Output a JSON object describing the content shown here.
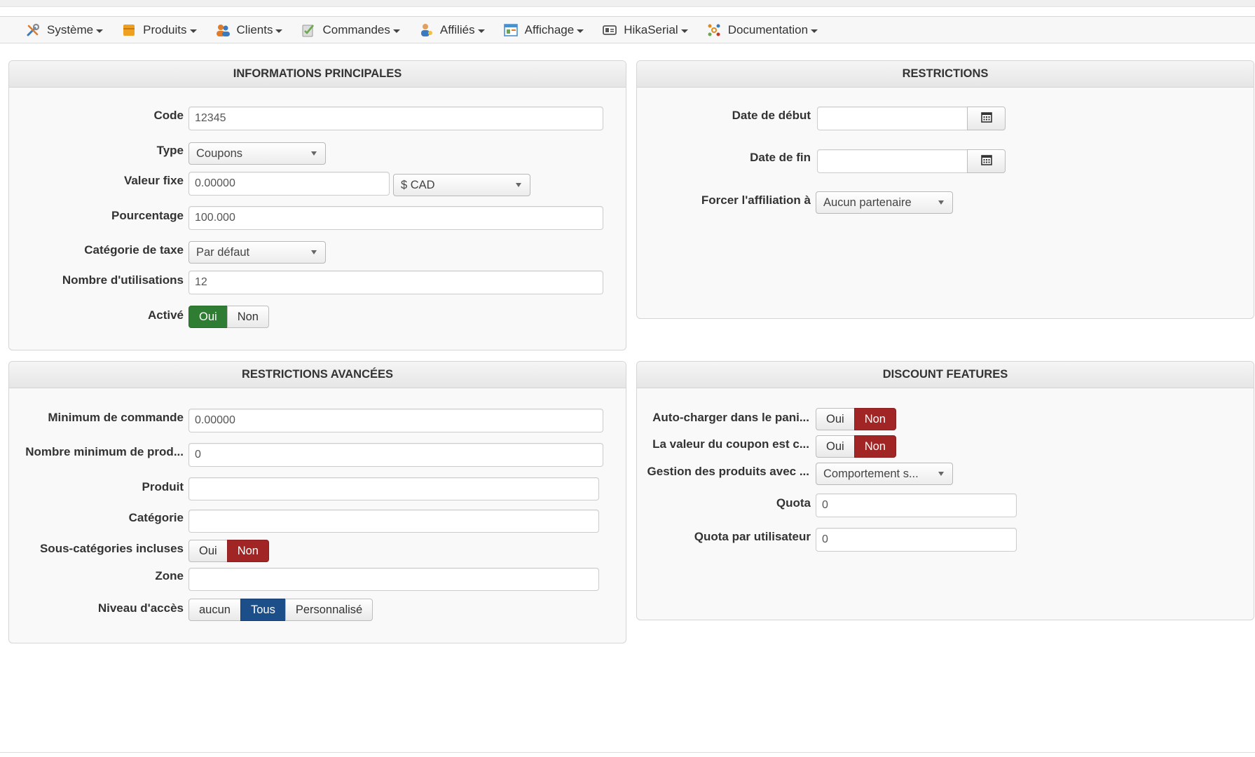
{
  "menu": [
    {
      "label": "Système",
      "icon": "tools-icon",
      "color": "#3a7bbf"
    },
    {
      "label": "Produits",
      "icon": "products-box-icon",
      "color": "#f0a020"
    },
    {
      "label": "Clients",
      "icon": "users-icon",
      "color": "#e07b2a"
    },
    {
      "label": "Commandes",
      "icon": "orders-icon",
      "color": "#6aa84f"
    },
    {
      "label": "Affiliés",
      "icon": "affiliates-icon",
      "color": "#3a7bbf"
    },
    {
      "label": "Affichage",
      "icon": "display-icon",
      "color": "#4a8fd0"
    },
    {
      "label": "HikaSerial",
      "icon": "serial-icon",
      "color": "#555555"
    },
    {
      "label": "Documentation",
      "icon": "documentation-icon",
      "color": "#e08a20"
    }
  ],
  "main_info": {
    "title": "INFORMATIONS PRINCIPALES",
    "code_label": "Code",
    "code_value": "12345",
    "type_label": "Type",
    "type_value": "Coupons",
    "fixed_label": "Valeur fixe",
    "fixed_value": "0.00000",
    "currency_value": "$ CAD",
    "percent_label": "Pourcentage",
    "percent_value": "100.000",
    "tax_label": "Catégorie de taxe",
    "tax_value": "Par défaut",
    "uses_label": "Nombre d'utilisations",
    "uses_value": "12",
    "active_label": "Activé",
    "yes": "Oui",
    "no": "Non"
  },
  "restrictions": {
    "title": "RESTRICTIONS",
    "start_label": "Date de début",
    "start_value": "",
    "end_label": "Date de fin",
    "end_value": "",
    "affil_label": "Forcer l'affiliation à",
    "affil_value": "Aucun partenaire"
  },
  "advanced": {
    "title": "RESTRICTIONS AVANCÉES",
    "min_order_label": "Minimum de commande",
    "min_order_value": "0.00000",
    "min_products_label": "Nombre minimum de prod...",
    "min_products_value": "0",
    "product_label": "Produit",
    "product_value": "",
    "category_label": "Catégorie",
    "category_value": "",
    "subcat_label": "Sous-catégories incluses",
    "yes": "Oui",
    "no": "Non",
    "zone_label": "Zone",
    "zone_value": "",
    "access_label": "Niveau d'accès",
    "access_none": "aucun",
    "access_all": "Tous",
    "access_custom": "Personnalisé"
  },
  "discount": {
    "title": "DISCOUNT FEATURES",
    "autoload_label": "Auto-charger dans le pani...",
    "value_label": "La valeur du coupon est c...",
    "yes": "Oui",
    "no": "Non",
    "products_label": "Gestion des produits avec ...",
    "products_value": "Comportement s...",
    "quota_label": "Quota",
    "quota_value": "0",
    "quota_user_label": "Quota par utilisateur",
    "quota_user_value": "0"
  }
}
